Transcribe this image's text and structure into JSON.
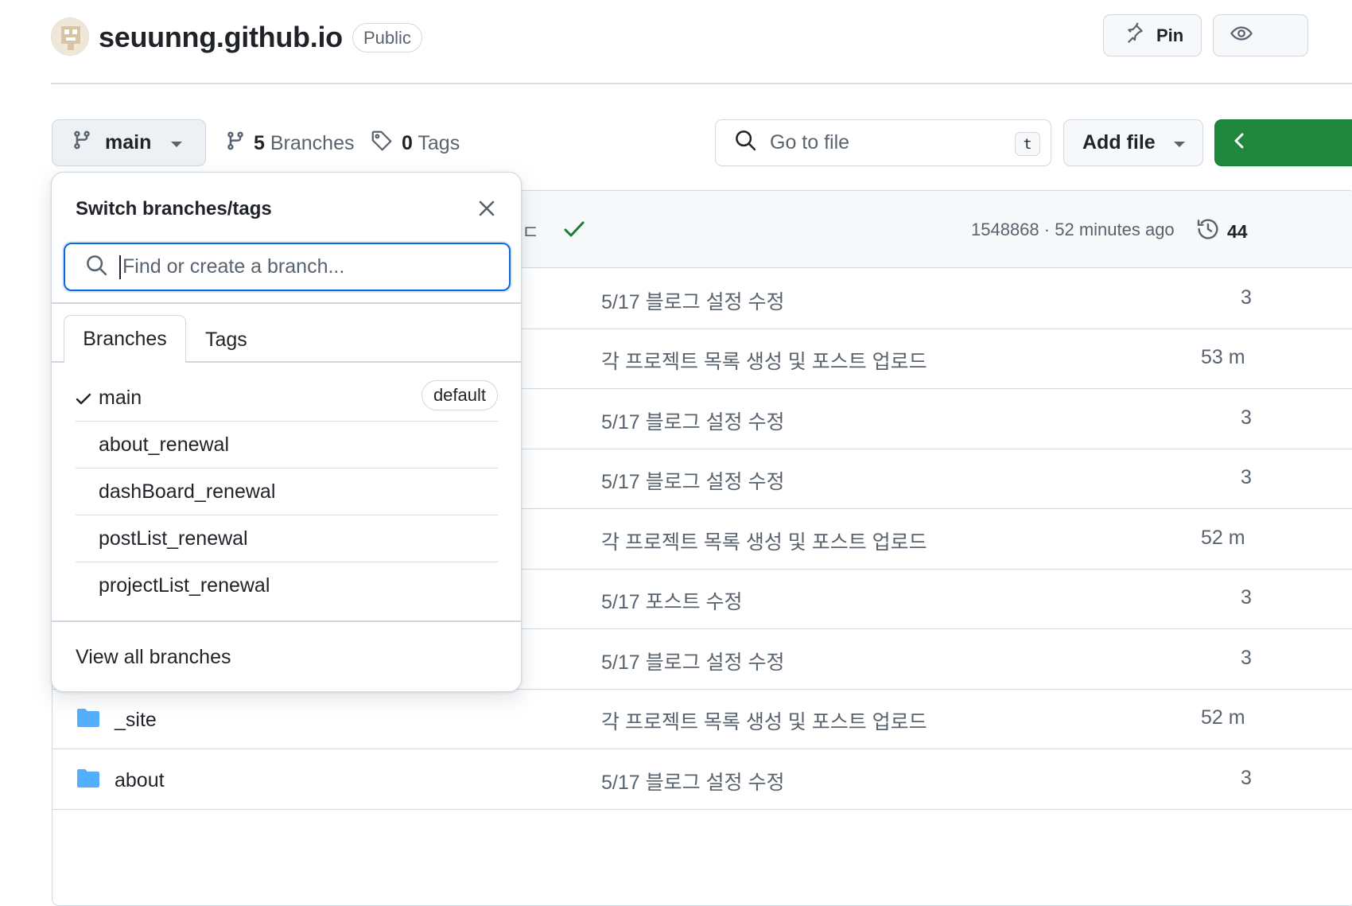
{
  "repo": {
    "name": "seuunng.github.io",
    "visibility": "Public",
    "pin_label": "Pin"
  },
  "toolbar": {
    "branch": "main",
    "branches_count": "5",
    "branches_label": "Branches",
    "tags_count": "0",
    "tags_label": "Tags",
    "goto_placeholder": "Go to file",
    "goto_shortcut": "t",
    "add_file_label": "Add file"
  },
  "latest_commit": {
    "message_fragment": "ㄷ",
    "hash": "1548868",
    "time": "52 minutes ago",
    "separator": "·",
    "history_count": "44"
  },
  "files": [
    {
      "message": "5/17 블로그 설정 수정",
      "time": "3"
    },
    {
      "message": "각 프로젝트 목록 생성 및 포스트 업로드",
      "time": "53 m"
    },
    {
      "message": "5/17 블로그 설정 수정",
      "time": "3"
    },
    {
      "message": "5/17 블로그 설정 수정",
      "time": "3"
    },
    {
      "message": "각 프로젝트 목록 생성 및 포스트 업로드",
      "time": "52 m"
    },
    {
      "message": "5/17 포스트 수정",
      "time": "3"
    },
    {
      "message": "5/17 블로그 설정 수정",
      "time": "3"
    },
    {
      "name": "_site",
      "message": "각 프로젝트 목록 생성 및 포스트 업로드",
      "time": "52 m"
    },
    {
      "name": "about",
      "message": "5/17 블로그 설정 수정",
      "time": "3"
    }
  ],
  "dropdown": {
    "title": "Switch branches/tags",
    "search_placeholder": "Find or create a branch...",
    "tabs": [
      "Branches",
      "Tags"
    ],
    "branches": [
      {
        "name": "main",
        "selected": true,
        "badge": "default"
      },
      {
        "name": "about_renewal"
      },
      {
        "name": "dashBoard_renewal"
      },
      {
        "name": "postList_renewal"
      },
      {
        "name": "projectList_renewal"
      }
    ],
    "view_all": "View all branches"
  },
  "colors": {
    "accent_blue": "#0969da",
    "success_green": "#1f883d",
    "folder_blue": "#54aeff",
    "muted_text": "#59636e",
    "border": "#d0d7de"
  }
}
